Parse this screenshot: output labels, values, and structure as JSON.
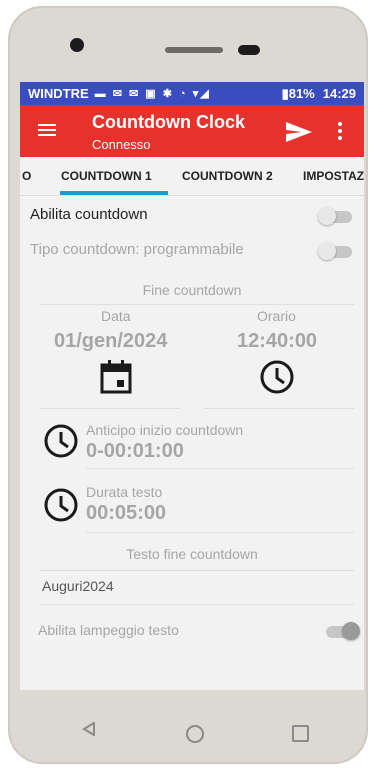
{
  "statusbar": {
    "carrier": "WINDTRE",
    "battery": "81%",
    "time": "14:29"
  },
  "appbar": {
    "title": "Countdown Clock",
    "subtitle": "Connesso",
    "bg_color": "#e5322d"
  },
  "tabs": [
    {
      "label": "O"
    },
    {
      "label": "COUNTDOWN 1",
      "active": true
    },
    {
      "label": "COUNTDOWN 2"
    },
    {
      "label": "IMPOSTAZ"
    }
  ],
  "settings": {
    "enable_countdown_label": "Abilita countdown",
    "enable_countdown": false,
    "countdown_type_label": "Tipo countdown: programmabile",
    "countdown_type": false,
    "end_section_title": "Fine countdown",
    "date_label": "Data",
    "date_value": "01/gen/2024",
    "time_label": "Orario",
    "time_value": "12:40:00",
    "advance_label": "Anticipo inizio countdown",
    "advance_value": "0-00:01:00",
    "duration_label": "Durata testo",
    "duration_value": "00:05:00",
    "text_section_title": "Testo fine countdown",
    "text_value": "Auguri2024",
    "blink_label": "Abilita lampeggio testo",
    "blink": true
  },
  "icons": {
    "menu": "menu-icon",
    "send": "send-icon",
    "overflow": "overflow-menu-icon",
    "calendar": "calendar-icon",
    "clock": "clock-icon"
  }
}
